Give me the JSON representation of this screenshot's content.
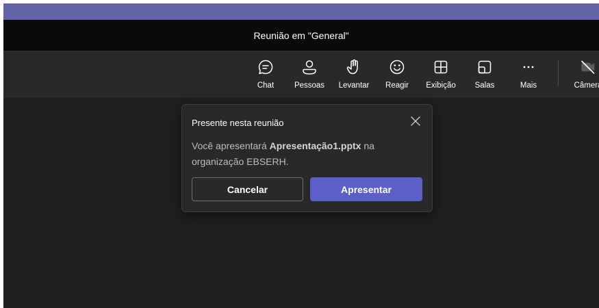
{
  "window": {
    "title": "Reunião em \"General\""
  },
  "toolbar": {
    "items": [
      {
        "label": "Chat",
        "icon": "chat-icon"
      },
      {
        "label": "Pessoas",
        "icon": "people-icon"
      },
      {
        "label": "Levantar",
        "icon": "raise-hand-icon"
      },
      {
        "label": "Reagir",
        "icon": "smiley-icon"
      },
      {
        "label": "Exibição",
        "icon": "grid-view-icon"
      },
      {
        "label": "Salas",
        "icon": "breakout-rooms-icon"
      },
      {
        "label": "Mais",
        "icon": "more-icon"
      },
      {
        "label": "Câmera",
        "icon": "camera-off-icon"
      }
    ]
  },
  "dialog": {
    "title": "Presente nesta reunião",
    "message_before": "Você apresentará ",
    "file_name": "Apresentação1.pptx",
    "message_after": " na organização EBSERH.",
    "cancel_label": "Cancelar",
    "present_label": "Apresentar"
  },
  "colors": {
    "accent": "#6264a7",
    "title_bar": "#0a0a0a",
    "toolbar": "#292929",
    "stage": "#1f1f1f",
    "primary_button": "#5b5fc7"
  }
}
